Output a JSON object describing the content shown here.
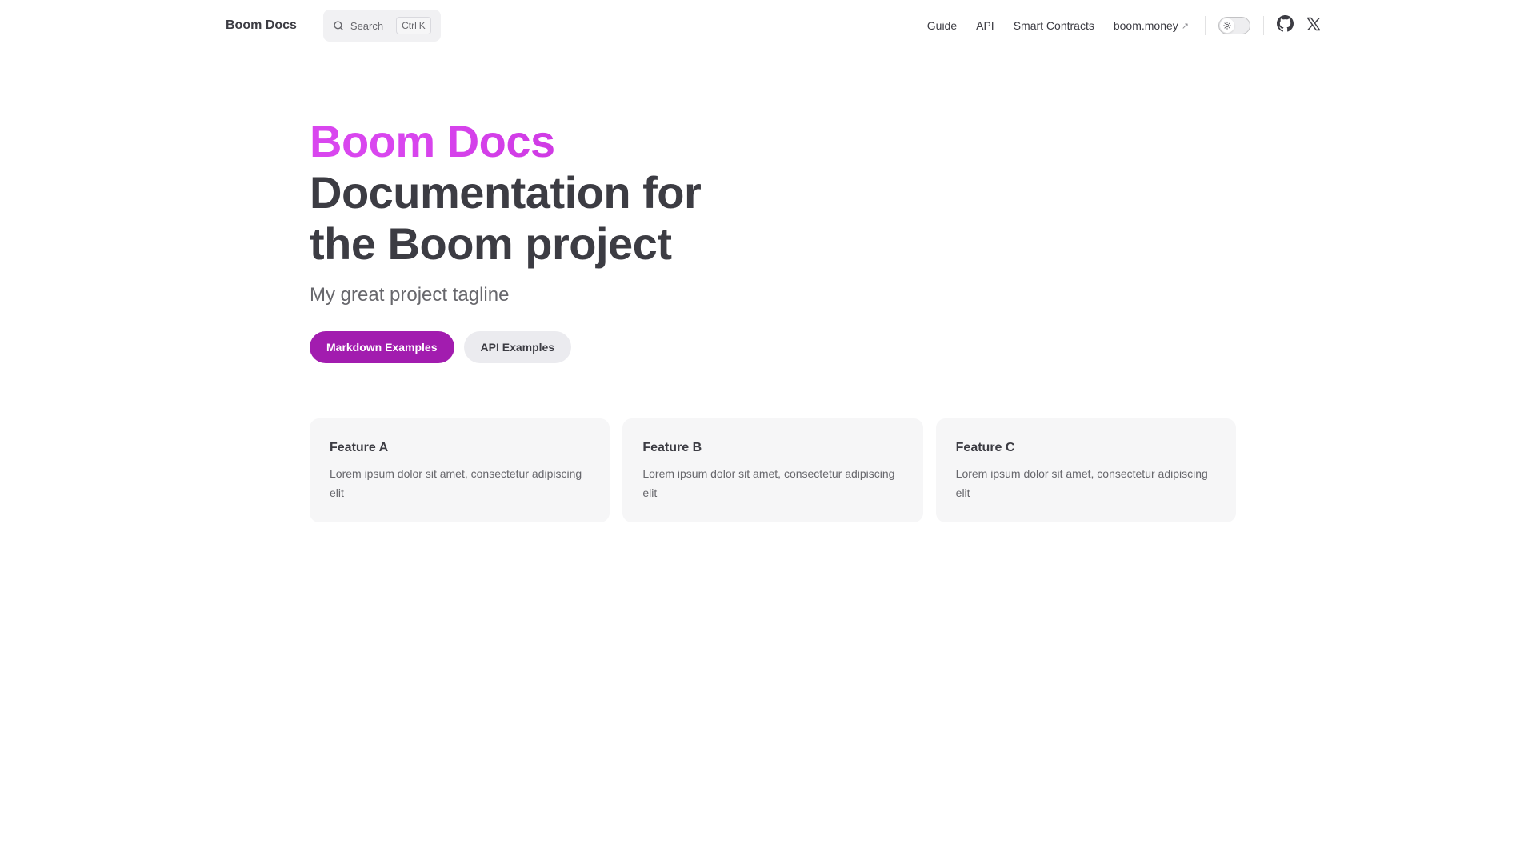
{
  "nav": {
    "brand": "Boom Docs",
    "search": {
      "label": "Search",
      "key_modifier": "Ctrl",
      "key": "K"
    },
    "links": [
      {
        "label": "Guide"
      },
      {
        "label": "API"
      },
      {
        "label": "Smart Contracts"
      },
      {
        "label": "boom.money",
        "external_arrow": "↗"
      }
    ],
    "appearance_icon": "sun-icon",
    "social": [
      {
        "icon": "github-icon"
      },
      {
        "icon": "x-twitter-icon"
      }
    ]
  },
  "hero": {
    "name": "Boom Docs",
    "text": "Documentation for the Boom project",
    "tagline": "My great project tagline",
    "actions": [
      {
        "label": "Markdown Examples",
        "theme": "brand"
      },
      {
        "label": "API Examples",
        "theme": "alt"
      }
    ]
  },
  "features": [
    {
      "title": "Feature A",
      "details": "Lorem ipsum dolor sit amet, consectetur adipiscing elit"
    },
    {
      "title": "Feature B",
      "details": "Lorem ipsum dolor sit amet, consectetur adipiscing elit"
    },
    {
      "title": "Feature C",
      "details": "Lorem ipsum dolor sit amet, consectetur adipiscing elit"
    }
  ],
  "colors": {
    "brand_gradient_start": "#d946ef",
    "brand_button": "#a21caf",
    "text_primary": "#3c3c43",
    "text_secondary": "#67676c",
    "card_bg": "#f6f6f7"
  }
}
